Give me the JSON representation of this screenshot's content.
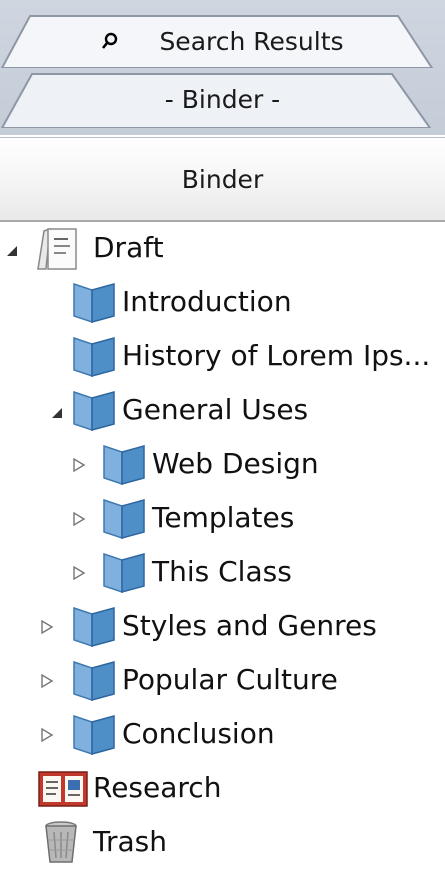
{
  "tabs": {
    "search_results": "Search Results",
    "binder": "- Binder -"
  },
  "header": {
    "title": "Binder"
  },
  "tree": {
    "draft": "Draft",
    "introduction": "Introduction",
    "history": "History of Lorem Ips...",
    "general_uses": "General Uses",
    "web_design": "Web Design",
    "templates": "Templates",
    "this_class": "This Class",
    "styles_genres": "Styles and Genres",
    "popular_culture": "Popular Culture",
    "conclusion": "Conclusion",
    "research": "Research",
    "trash": "Trash"
  },
  "icons": {
    "search": "magnifier-icon",
    "draft": "draft-document-icon",
    "folder": "blue-binder-folder-icon",
    "research": "research-icon",
    "trash": "trash-can-icon",
    "expanded": "triangle-expanded-icon",
    "collapsed": "triangle-collapsed-icon"
  },
  "colors": {
    "tab_bg": "#c4ccd8",
    "folder_blue": "#4f8fc8",
    "research_red": "#c0392b"
  }
}
